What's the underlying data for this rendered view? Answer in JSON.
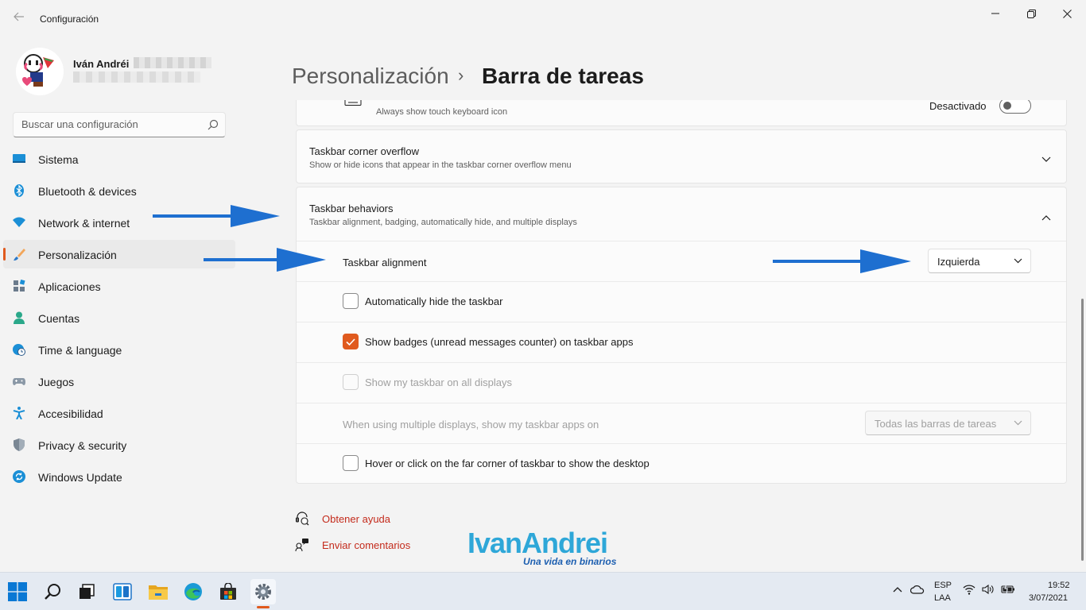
{
  "window": {
    "title": "Configuración"
  },
  "user": {
    "name": "Iván Andréi"
  },
  "search": {
    "placeholder": "Buscar una configuración"
  },
  "sidebar": {
    "items": [
      {
        "label": "Sistema",
        "icon": "system-icon"
      },
      {
        "label": "Bluetooth & devices",
        "icon": "bluetooth-icon"
      },
      {
        "label": "Network & internet",
        "icon": "wifi-icon"
      },
      {
        "label": "Personalización",
        "icon": "brush-icon",
        "active": true
      },
      {
        "label": "Aplicaciones",
        "icon": "apps-icon"
      },
      {
        "label": "Cuentas",
        "icon": "account-icon"
      },
      {
        "label": "Time & language",
        "icon": "globe-clock-icon"
      },
      {
        "label": "Juegos",
        "icon": "gamepad-icon"
      },
      {
        "label": "Accesibilidad",
        "icon": "accessibility-icon"
      },
      {
        "label": "Privacy & security",
        "icon": "shield-icon"
      },
      {
        "label": "Windows Update",
        "icon": "update-icon"
      }
    ]
  },
  "breadcrumb": {
    "parent": "Personalización",
    "separator": "›",
    "current": "Barra de tareas"
  },
  "touch_keyboard": {
    "desc": "Always show touch keyboard icon",
    "state_label": "Desactivado",
    "on": false
  },
  "corner_overflow": {
    "title": "Taskbar corner overflow",
    "desc": "Show or hide icons that appear in the taskbar corner overflow menu"
  },
  "behaviors": {
    "title": "Taskbar behaviors",
    "desc": "Taskbar alignment, badging, automatically hide, and multiple displays",
    "alignment_label": "Taskbar alignment",
    "alignment_value": "Izquierda",
    "options": [
      {
        "label": "Automatically hide the taskbar",
        "checked": false,
        "disabled": false
      },
      {
        "label": "Show badges (unread messages counter) on taskbar apps",
        "checked": true,
        "disabled": false
      },
      {
        "label": "Show my taskbar on all displays",
        "checked": false,
        "disabled": true
      }
    ],
    "multi_display_label": "When using multiple displays, show my taskbar apps on",
    "multi_display_value": "Todas las barras de tareas",
    "corner_label": "Hover or click on the far corner of taskbar to show the desktop"
  },
  "footer": {
    "help": "Obtener ayuda",
    "feedback": "Enviar comentarios"
  },
  "watermark": {
    "main": "IvanAndrei",
    "sub": "Una vida en binarios"
  },
  "taskbar": {
    "lang_top": "ESP",
    "lang_bottom": "LAA",
    "time": "19:52",
    "date": "3/07/2021"
  },
  "colors": {
    "accent": "#e05a1e",
    "link": "#c42b1c",
    "arrow": "#1e6fd0",
    "watermark": "#2ea7d8"
  }
}
